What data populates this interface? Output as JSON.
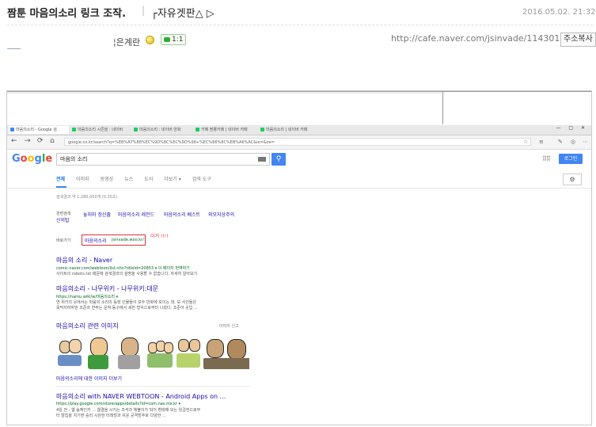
{
  "post": {
    "title": "짬툰 마음의소리 링크 조작.",
    "separator": "|",
    "board": "┌자유겟판△ ▷",
    "date": "2016.05.02. 21:32",
    "author": "¦은계란",
    "comment_count": "1:1",
    "url": "http://cafe.naver.com/jsinvade/114301",
    "copy_button": "주소복사"
  },
  "browser": {
    "tabs": [
      {
        "label": "마음의소리 - Google 검",
        "color": "#4285f4"
      },
      {
        "label": "마음의소리 시즌을 : 네이버",
        "color": "#19ce60"
      },
      {
        "label": "마음의소리 : 네이버 만화",
        "color": "#19ce60"
      },
      {
        "label": "카페 짬뽕카페 | 네이버 카페",
        "color": "#19ce60"
      },
      {
        "label": "마음의소리 | 네이버 카페",
        "color": "#19ce60"
      }
    ],
    "window_controls": "— □ ✕",
    "url": "google.co.kr/search?q=%EB%A7%88%EC%9D%8C%EC%9D%98+%EC%86%8C%EB%A6%AC&ie=&oe=",
    "nav_back": "←",
    "nav_forward": "→",
    "nav_reload": "⟳",
    "nav_home": "⌂"
  },
  "google": {
    "logo": [
      "G",
      "o",
      "o",
      "g",
      "l",
      "e"
    ],
    "logo_colors": [
      "#4285f4",
      "#ea4335",
      "#fbbc05",
      "#4285f4",
      "#34a853",
      "#ea4335"
    ],
    "query": "마음의 소리",
    "login": "로그인",
    "tabs": [
      "전체",
      "이미지",
      "동영상",
      "뉴스",
      "도서",
      "더보기 ▾",
      "검색 도구"
    ],
    "result_count": "검색결과 약 1,280,000개 (0.35초)",
    "related_label": "관련검색",
    "related": [
      "놓지마 정신줄",
      "마음의소리 레전드",
      "마음의소리 베스트",
      "외모지상주의",
      "신의탑"
    ],
    "shortcut_label": "바로가기",
    "shortcut_link": "마음의소리",
    "shortcut_url": "jsinvade.woo.kr/",
    "annotation": "이거 !!!!",
    "results": [
      {
        "title": "마음의 소리 - Naver",
        "url": "comic.naver.com/webtoon/list.nhn?titleId=20853 ▾ 이 페이지 번역하기",
        "snippet": [
          "사이트의 robots.txt 때문에 검색결과의 설명을 사용할 수 없습니다. 자세히 알아보기"
        ]
      },
      {
        "title": "마음의소리 - 나무위키 - 나무위키:대문",
        "url": "https://namu.wiki/w/마음의소리 ▾",
        "snippet": [
          "연 위키의 웃에서는 마음의 소리의 등장 인물들이 모두 만화에 모이는 데, 모 사건들은",
          "목막지하하번 조준과 연주는 운적 동구에서 세번 형식으로부터 나왔다. 조준어 웃입 ..."
        ]
      },
      {
        "title": "마음의소리 with NAVER WEBTOON - Android Apps on ...",
        "url": "https://play.google.com/store/apps/details?id=com.nas.ms.kr ▾",
        "snippet": [
          "4일 전 - 웹 숲케인카 ... 웹결을 시키는 조석과 헤불이가 되어 환태때 모는 임걸전으로부",
          "터 탈집을 치기면 승리 시원한 터래멍과 쉬운 공격방주로 다양한 ..."
        ]
      }
    ],
    "images_heading": "마음의소리 관련 이미지",
    "images_more": "이미지 신고",
    "images_link": "마음의소리에 대한 이미지 더보기"
  }
}
